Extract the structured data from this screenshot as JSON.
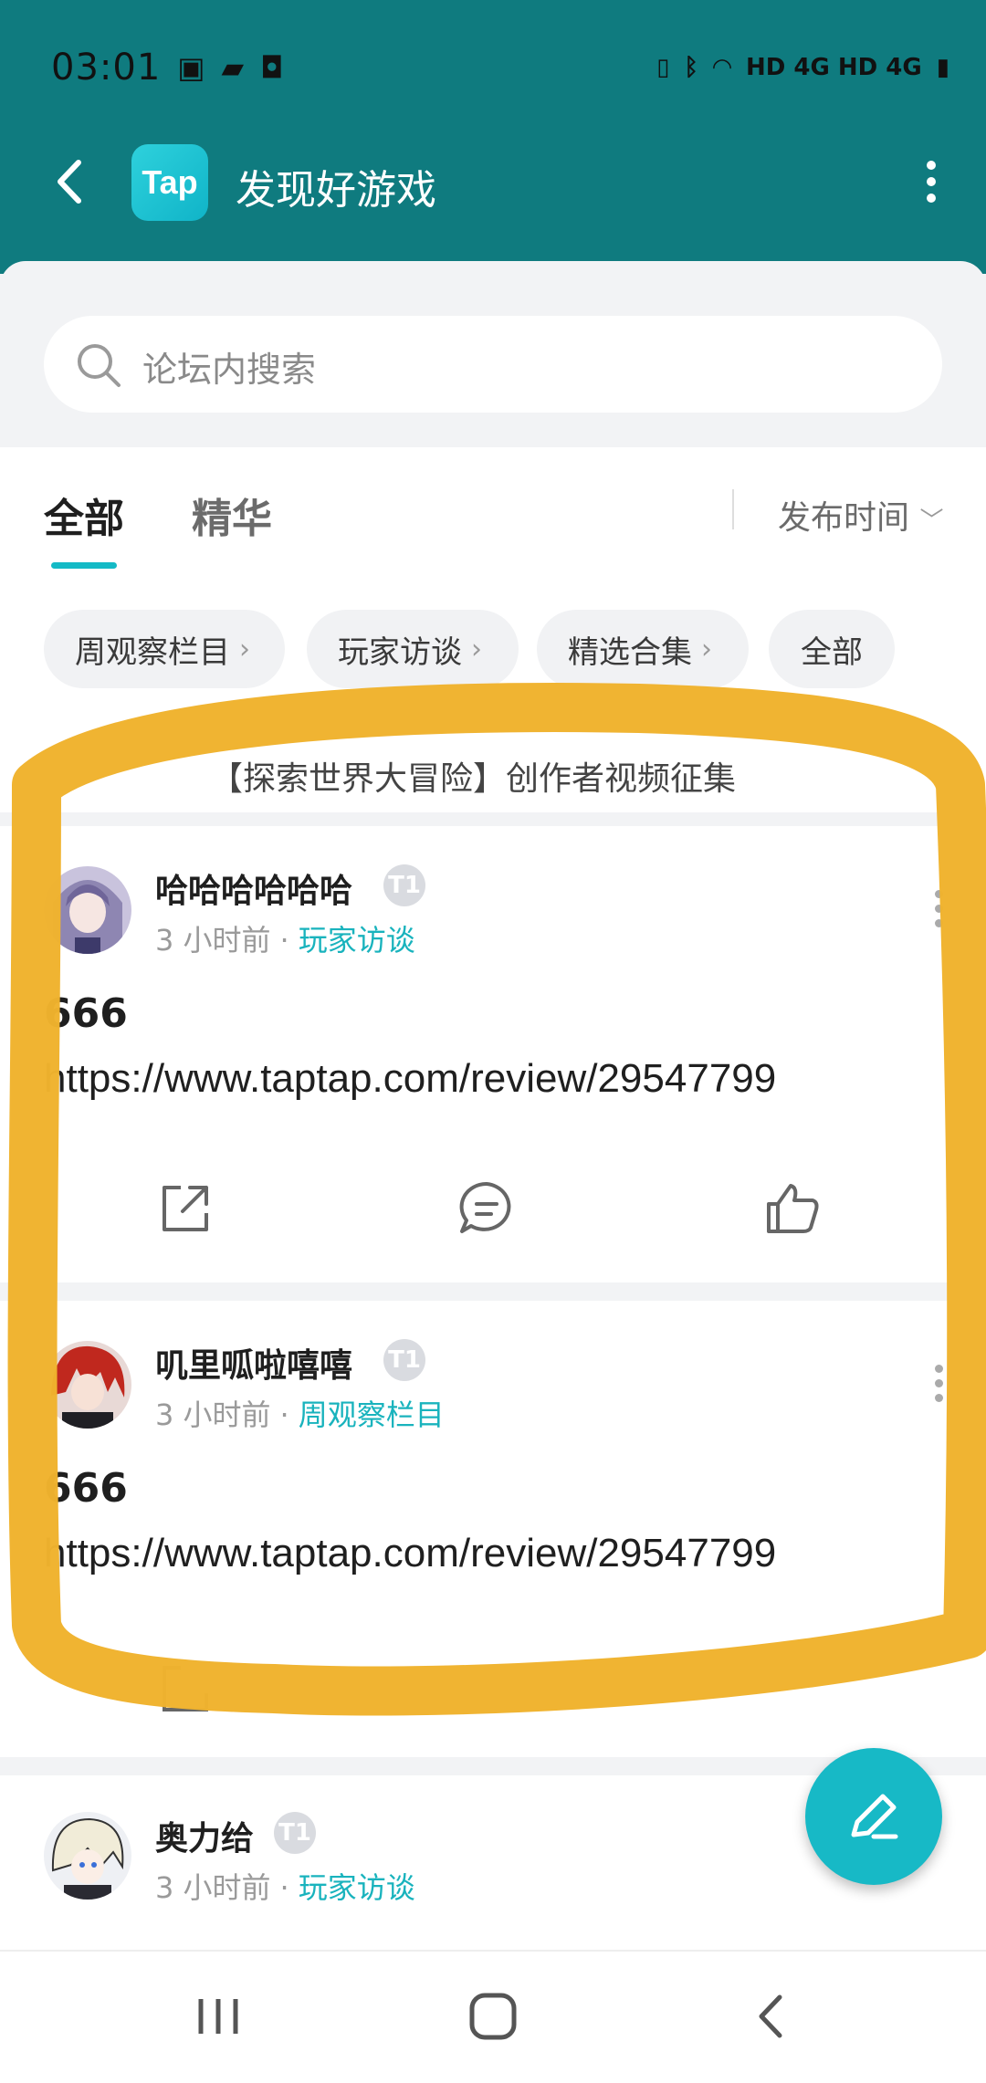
{
  "status_bar": {
    "time": "03:01",
    "right_indicators": "HD 4G HD 4G"
  },
  "app_bar": {
    "logo_text": "Tap",
    "title": "发现好游戏"
  },
  "search": {
    "placeholder": "论坛内搜索"
  },
  "tabs": [
    {
      "label": "全部",
      "selected": true
    },
    {
      "label": "精华",
      "selected": false
    }
  ],
  "sort": {
    "label": "发布时间"
  },
  "chips": [
    {
      "label": "周观察栏目",
      "has_arrow": true
    },
    {
      "label": "玩家访谈",
      "has_arrow": true
    },
    {
      "label": "精选合集",
      "has_arrow": true
    },
    {
      "label": "全部",
      "has_arrow": false
    }
  ],
  "notice": {
    "text": "【探索世界大冒险】创作者视频征集"
  },
  "posts": [
    {
      "user": "哈哈哈哈哈哈",
      "badge": "T1",
      "time": "3 小时前",
      "category": "玩家访谈",
      "title": "666",
      "link": "https://www.taptap.com/review/29547799"
    },
    {
      "user": "叽里呱啦嘻嘻",
      "badge": "T1",
      "time": "3 小时前",
      "category": "周观察栏目",
      "title": "666",
      "link": "https://www.taptap.com/review/29547799"
    },
    {
      "user": "奥力给",
      "badge": "T1",
      "time": "3 小时前",
      "category": "玩家访谈",
      "title": "",
      "link": ""
    }
  ],
  "colors": {
    "header": "#0f7b7f",
    "accent": "#19b3bd",
    "highlight": "#f0b22e"
  }
}
